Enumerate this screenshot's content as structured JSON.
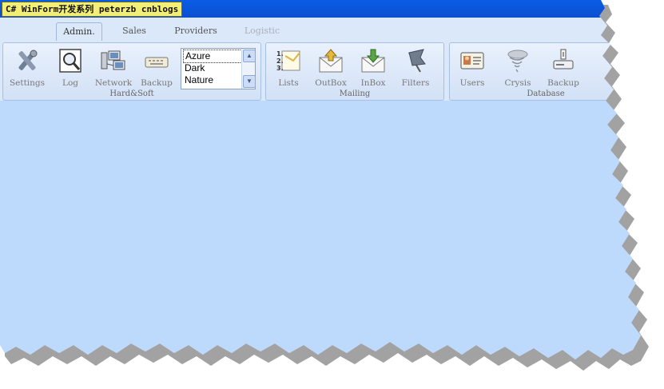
{
  "window": {
    "title": "C# WinForm开发系列 peterzb cnblogs"
  },
  "tabs": [
    {
      "label": "Admin.",
      "state": "active"
    },
    {
      "label": "Sales",
      "state": "normal"
    },
    {
      "label": "Providers",
      "state": "normal"
    },
    {
      "label": "Logistic",
      "state": "disabled"
    }
  ],
  "groups": {
    "hardsoft": {
      "caption": "Hard&Soft",
      "buttons": [
        {
          "label": "Settings",
          "icon": "tools-icon"
        },
        {
          "label": "Log",
          "icon": "magnifier-document-icon"
        },
        {
          "label": "Network",
          "icon": "network-computers-icon"
        },
        {
          "label": "Backup",
          "icon": "keyboard-icon"
        }
      ],
      "theme_list": {
        "items": [
          "Azure",
          "Dark",
          "Nature"
        ],
        "selected": "Azure"
      }
    },
    "mailing": {
      "caption": "Mailing",
      "buttons": [
        {
          "label": "Lists",
          "icon": "numbered-list-icon"
        },
        {
          "label": "OutBox",
          "icon": "envelope-up-icon"
        },
        {
          "label": "InBox",
          "icon": "envelope-down-icon"
        },
        {
          "label": "Filters",
          "icon": "flag-icon"
        }
      ]
    },
    "database": {
      "caption": "Database",
      "buttons": [
        {
          "label": "Users",
          "icon": "id-card-icon"
        },
        {
          "label": "Crysis",
          "icon": "tornado-icon"
        },
        {
          "label": "Backup",
          "icon": "drive-icon"
        }
      ]
    }
  },
  "colors": {
    "titlebar": "#0b55dc",
    "title_label_bg": "#f2ef74",
    "content_bg": "#bdd9fb",
    "ribbon_bg": "#dbe8fa"
  }
}
